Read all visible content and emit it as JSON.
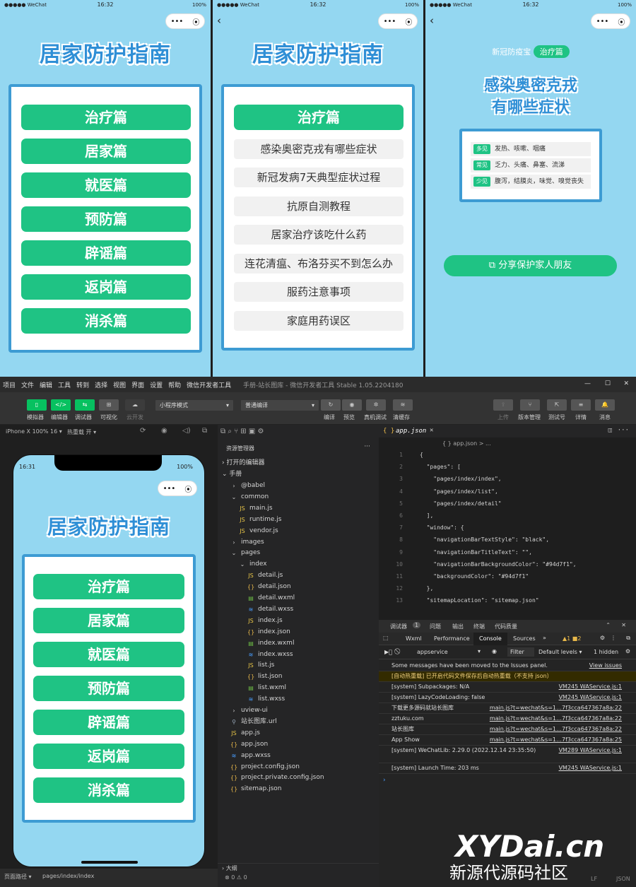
{
  "phone_status": {
    "signal": "●●●●● WeChat",
    "time1": "16:32",
    "battery": "100%"
  },
  "capsule": {
    "more": "•••",
    "close": "⦿"
  },
  "screen1": {
    "title": "居家防护指南",
    "buttons": [
      "治疗篇",
      "居家篇",
      "就医篇",
      "预防篇",
      "辟谣篇",
      "返岗篇",
      "消杀篇"
    ]
  },
  "screen2": {
    "title": "居家防护指南",
    "heading": "治疗篇",
    "items": [
      "感染奥密克戎有哪些症状",
      "新冠发病7天典型症状过程",
      "抗原自测教程",
      "居家治疗该吃什么药",
      "连花清瘟、布洛芬买不到怎么办",
      "服药注意事项",
      "家庭用药误区"
    ]
  },
  "screen3": {
    "brand": "新冠防疫宝",
    "tag": "治疗篇",
    "title_line1": "感染奥密克戎",
    "title_line2": "有哪些症状",
    "symptoms": [
      {
        "tag": "多见",
        "text": "发热、咳嗽、咽痛"
      },
      {
        "tag": "常见",
        "text": "乏力、头痛、鼻塞、流涕"
      },
      {
        "tag": "少见",
        "text": "腹泻，结膜炎，味觉、嗅觉丧失"
      }
    ],
    "share": "分享保护家人朋友"
  },
  "ide": {
    "menu": [
      "项目",
      "文件",
      "编辑",
      "工具",
      "转到",
      "选择",
      "视图",
      "界面",
      "设置",
      "帮助",
      "微信开发者工具"
    ],
    "window_title": "手册-站长图库 - 微信开发者工具 Stable 1.05.2204180",
    "toolbar_left": [
      "模拟器",
      "编辑器",
      "调试器",
      "可视化",
      "云开发"
    ],
    "mode_select": "小程序模式",
    "compile_select": "普通编译",
    "toolbar_mid": [
      "编译",
      "预览",
      "真机调试",
      "清缓存"
    ],
    "toolbar_right": [
      "上传",
      "版本管理",
      "测试号",
      "详情",
      "消息"
    ],
    "sim_device": "iPhone X 100% 16 ▾",
    "sim_hotreload": "热重载 开 ▾",
    "sim_time": "16:31",
    "sim_battery": "100%",
    "explorer_title": "资源管理器",
    "open_editors": "打开的编辑器",
    "project": "手册",
    "tree": [
      "@babel",
      "common",
      "main.js",
      "runtime.js",
      "vendor.js",
      "images",
      "pages",
      "index",
      "detail.js",
      "detail.json",
      "detail.wxml",
      "detail.wxss",
      "index.js",
      "index.json",
      "index.wxml",
      "index.wxss",
      "list.js",
      "list.json",
      "list.wxml",
      "list.wxss",
      "uview-ui",
      "站长图库.url",
      "app.js",
      "app.json",
      "app.wxss",
      "project.config.json",
      "project.private.config.json",
      "sitemap.json"
    ],
    "outline": "大纲",
    "status_path": "页面路径 ▾",
    "status_page": "pages/index/index",
    "status_errors": "⊗ 0 ⚠ 0",
    "tab_file": "app.json",
    "breadcrumb": "{ } app.json > ...",
    "code_lines": [
      {
        "n": "1",
        "t": "{"
      },
      {
        "n": "2",
        "t": "  \"pages\": ["
      },
      {
        "n": "3",
        "t": "    \"pages/index/index\","
      },
      {
        "n": "4",
        "t": "    \"pages/index/list\","
      },
      {
        "n": "5",
        "t": "    \"pages/index/detail\""
      },
      {
        "n": "6",
        "t": "  ],"
      },
      {
        "n": "7",
        "t": "  \"window\": {"
      },
      {
        "n": "8",
        "t": "    \"navigationBarTextStyle\": \"black\","
      },
      {
        "n": "9",
        "t": "    \"navigationBarTitleText\": \"\","
      },
      {
        "n": "10",
        "t": "    \"navigationBarBackgroundColor\": \"#94d7f1\","
      },
      {
        "n": "11",
        "t": "    \"backgroundColor\": \"#94d7f1\""
      },
      {
        "n": "12",
        "t": "  },"
      },
      {
        "n": "13",
        "t": "  \"sitemapLocation\": \"sitemap.json\""
      }
    ],
    "debug_tabs": [
      "调试器",
      "1",
      "问题",
      "输出",
      "终端",
      "代码质量"
    ],
    "devtools_tabs": [
      "Wxml",
      "Performance",
      "Console",
      "Sources",
      "»"
    ],
    "devtools_counts": "▲1 ■2",
    "console_context": "appservice",
    "console_filter": "Filter",
    "console_levels": "Default levels ▾",
    "console_hidden": "1 hidden",
    "logs": [
      {
        "t": "Some messages have been moved to the Issues panel.",
        "s": "View issues"
      },
      {
        "t": "[自动热重载] 已开启代码文件保存后自动热重载（不支持 json）",
        "s": ""
      },
      {
        "t": "[system] Subpackages: N/A",
        "s": "VM245 WAService.js:1"
      },
      {
        "t": "[system] LazyCodeLoading: false",
        "s": "VM245 WAService.js:1"
      },
      {
        "t": "下载更多源码就站长图库",
        "s": "main.js?t=wechat&s=1…7f3cca647367a8a:22"
      },
      {
        "t": "zztuku.com",
        "s": "main.js?t=wechat&s=1…7f3cca647367a8a:22"
      },
      {
        "t": "站长图库",
        "s": "main.js?t=wechat&s=1…7f3cca647367a8a:22"
      },
      {
        "t": "App Show",
        "s": "main.js?t=wechat&s=1…7f3cca647367a8a:25"
      },
      {
        "t": "[system] WeChatLib: 2.29.0 (2022.12.14 23:35:50)",
        "s": "VM289 WAService.js:1"
      },
      {
        "t": "[system] Launch Time: 203 ms",
        "s": "VM245 WAService.js:1"
      }
    ],
    "statusbar_right": [
      "LF",
      "JSON"
    ]
  },
  "watermark": {
    "line1": "XYDai.cn",
    "line2": "新源代源码社区"
  }
}
